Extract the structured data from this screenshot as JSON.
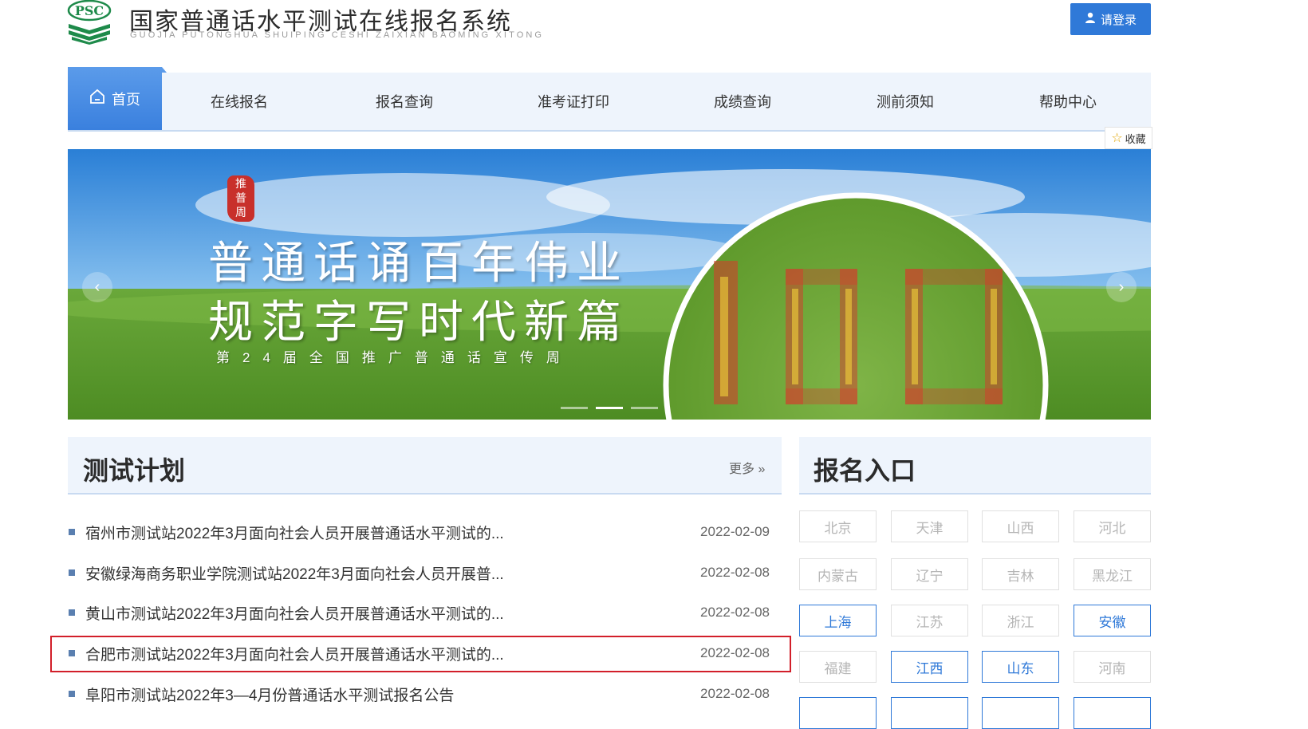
{
  "header": {
    "logo_text": "PSC",
    "title": "国家普通话水平测试在线报名系统",
    "subtitle": "GUOJIA PUTONGHUA SHUIPING CESHI ZAIXIAN BAOMING XITONG",
    "login_label": "请登录"
  },
  "nav": {
    "home": "首页",
    "items": [
      "在线报名",
      "报名查询",
      "准考证打印",
      "成绩查询",
      "测前须知",
      "帮助中心"
    ],
    "favorite": "收藏"
  },
  "banner": {
    "seal": [
      "推",
      "普",
      "周"
    ],
    "slogan1": "普通话诵百年伟业",
    "slogan2": "规范字写时代新篇",
    "slogan3": "第24届全国推广普通话宣传周",
    "active_slide": 2,
    "slide_count": 3
  },
  "plan": {
    "title": "测试计划",
    "more": "更多 »",
    "items": [
      {
        "title": "宿州市测试站2022年3月面向社会人员开展普通话水平测试的...",
        "date": "2022-02-09"
      },
      {
        "title": "安徽绿海商务职业学院测试站2022年3月面向社会人员开展普...",
        "date": "2022-02-08"
      },
      {
        "title": "黄山市测试站2022年3月面向社会人员开展普通话水平测试的...",
        "date": "2022-02-08"
      },
      {
        "title": "合肥市测试站2022年3月面向社会人员开展普通话水平测试的...",
        "date": "2022-02-08"
      },
      {
        "title": "阜阳市测试站2022年3—4月份普通话水平测试报名公告",
        "date": "2022-02-08"
      }
    ]
  },
  "entry": {
    "title": "报名入口",
    "provinces": [
      {
        "name": "北京",
        "active": false
      },
      {
        "name": "天津",
        "active": false
      },
      {
        "name": "山西",
        "active": false
      },
      {
        "name": "河北",
        "active": false
      },
      {
        "name": "内蒙古",
        "active": false
      },
      {
        "name": "辽宁",
        "active": false
      },
      {
        "name": "吉林",
        "active": false
      },
      {
        "name": "黑龙江",
        "active": false
      },
      {
        "name": "上海",
        "active": true
      },
      {
        "name": "江苏",
        "active": false
      },
      {
        "name": "浙江",
        "active": false
      },
      {
        "name": "安徽",
        "active": true
      },
      {
        "name": "福建",
        "active": false
      },
      {
        "name": "江西",
        "active": true
      },
      {
        "name": "山东",
        "active": true
      },
      {
        "name": "河南",
        "active": false
      }
    ]
  },
  "colors": {
    "accent": "#2f79d8",
    "highlight": "#d21f2a",
    "nav_bg": "#eef4fc"
  }
}
